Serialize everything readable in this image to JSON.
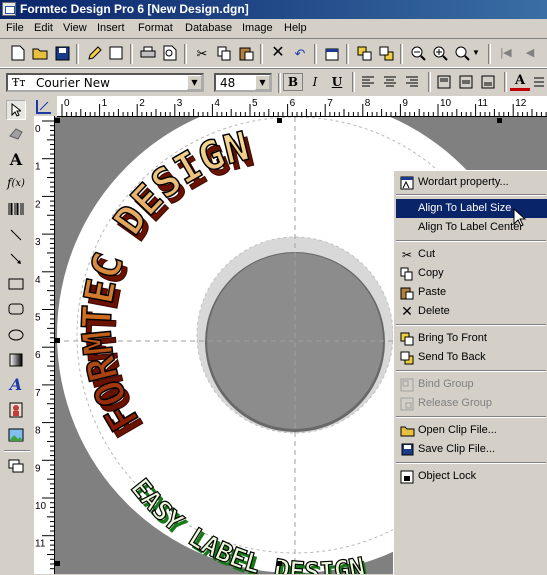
{
  "window": {
    "title": "Formtec Design Pro 6 [New Design.dgn]"
  },
  "menu": {
    "items": [
      "File",
      "Edit",
      "View",
      "Insert",
      "Format",
      "Database",
      "Image",
      "Help"
    ]
  },
  "format_bar": {
    "font_name": "Courier New",
    "font_size": "48",
    "bold": "B",
    "italic": "I",
    "underline": "U"
  },
  "ruler": {
    "h_ticks": [
      "0",
      "1",
      "2",
      "3",
      "4",
      "5",
      "6",
      "7",
      "8",
      "9",
      "10",
      "11",
      "12"
    ],
    "v_ticks": [
      "0",
      "1",
      "2",
      "3",
      "4",
      "5",
      "6",
      "7",
      "8",
      "9",
      "10",
      "11"
    ]
  },
  "design": {
    "arc_text_top": "FORMTEC DESIGN",
    "arc_text_bottom": "EASY LABEL DESIGN",
    "top_text_color": "#c04a10",
    "bottom_text_color": "#2a9a2a"
  },
  "context_menu": {
    "wordart": "Wordart property...",
    "align_size": "Align To Label Size",
    "align_center": "Align To Label Center",
    "cut": "Cut",
    "copy": "Copy",
    "paste": "Paste",
    "delete": "Delete",
    "bring_front": "Bring To Front",
    "send_back": "Send To Back",
    "bind_group": "Bind Group",
    "release_group": "Release Group",
    "open_clip": "Open Clip File...",
    "save_clip": "Save Clip File...",
    "object_lock": "Object Lock"
  },
  "colors": {
    "title_bar": "#0a246a",
    "menu_highlight": "#0a246a",
    "canvas_bg": "#808080",
    "face": "#d4d0c8"
  }
}
